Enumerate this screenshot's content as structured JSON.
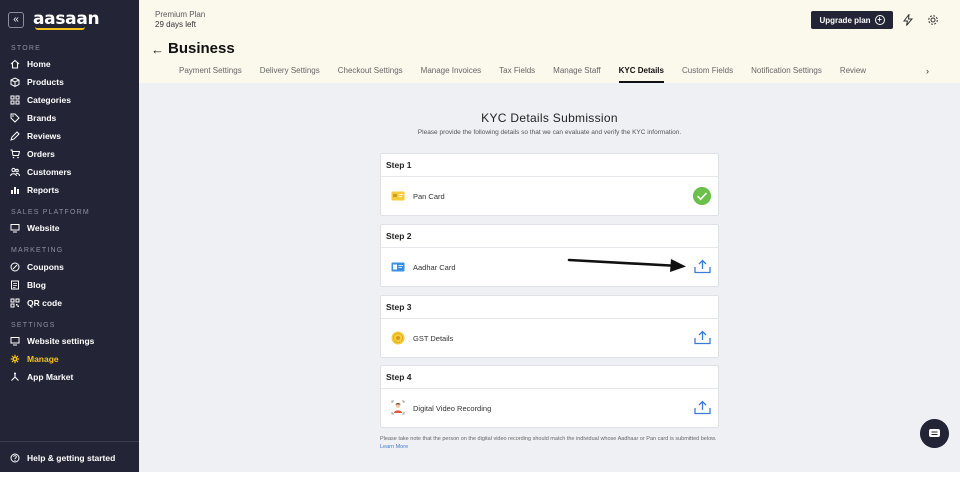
{
  "sidebar": {
    "logo": "aasaan",
    "collapse_icon": "double-chevron-left-icon",
    "sections": {
      "store": "STORE",
      "sales_platform": "SALES PLATFORM",
      "marketing": "MARKETING",
      "settings": "SETTINGS"
    },
    "items": {
      "home": {
        "label": "Home",
        "icon": "home-icon"
      },
      "products": {
        "label": "Products",
        "icon": "box-icon"
      },
      "categories": {
        "label": "Categories",
        "icon": "grid-icon"
      },
      "brands": {
        "label": "Brands",
        "icon": "tag-icon"
      },
      "reviews": {
        "label": "Reviews",
        "icon": "pen-icon"
      },
      "orders": {
        "label": "Orders",
        "icon": "cart-icon"
      },
      "customers": {
        "label": "Customers",
        "icon": "users-icon"
      },
      "reports": {
        "label": "Reports",
        "icon": "bar-chart-icon"
      },
      "website": {
        "label": "Website",
        "icon": "monitor-icon"
      },
      "coupons": {
        "label": "Coupons",
        "icon": "coupon-icon"
      },
      "blog": {
        "label": "Blog",
        "icon": "document-icon"
      },
      "qr_code": {
        "label": "QR code",
        "icon": "qr-icon"
      },
      "website_settings": {
        "label": "Website settings",
        "icon": "monitor-icon"
      },
      "manage": {
        "label": "Manage",
        "icon": "gear-icon"
      },
      "app_market": {
        "label": "App Market",
        "icon": "apps-icon"
      }
    },
    "help": {
      "label": "Help & getting started",
      "icon": "help-icon"
    },
    "active_color": "#f4c21a",
    "bg_color": "#232537"
  },
  "header": {
    "plan_name": "Premium Plan",
    "plan_days": "29 days left",
    "upgrade_label": "Upgrade plan",
    "title": "Business",
    "tabs": [
      "Payment Settings",
      "Delivery Settings",
      "Checkout Settings",
      "Manage Invoices",
      "Tax Fields",
      "Manage Staff",
      "KYC Details",
      "Custom Fields",
      "Notification Settings",
      "Review"
    ],
    "active_tab": "KYC Details"
  },
  "kyc": {
    "title": "KYC Details Submission",
    "subtitle": "Please provide the following details so that we can evaluate and verify the KYC information.",
    "steps": [
      {
        "step": "Step 1",
        "doc": "Pan Card",
        "icon": "pan-card-icon",
        "status": "completed"
      },
      {
        "step": "Step 2",
        "doc": "Aadhar Card",
        "icon": "aadhar-card-icon",
        "status": "upload"
      },
      {
        "step": "Step 3",
        "doc": "GST Details",
        "icon": "gst-badge-icon",
        "status": "upload"
      },
      {
        "step": "Step 4",
        "doc": "Digital Video Recording",
        "icon": "video-person-icon",
        "status": "upload"
      }
    ],
    "note": "Please take note that the person on the digital video recording should match the individual whose Aadhaar or Pan card is submitted below.",
    "learn_more": "Learn More",
    "accent_color": "#3a7bd5",
    "success_color": "#6cc04a"
  }
}
